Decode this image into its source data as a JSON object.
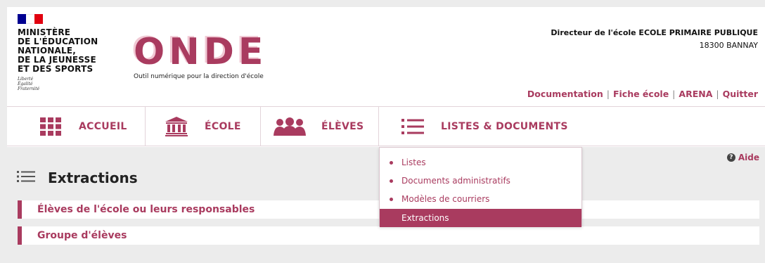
{
  "header": {
    "ministry_lines": [
      "MINISTÈRE",
      "DE L'ÉDUCATION",
      "NATIONALE,",
      "DE LA JEUNESSE",
      "ET DES SPORTS"
    ],
    "motto_lines": [
      "Liberté",
      "Égalité",
      "Fraternité"
    ],
    "app_title": "ONDE",
    "app_subtitle": "Outil numérique pour la direction d'école",
    "director_label": "Directeur de l'école ECOLE PRIMAIRE PUBLIQUE",
    "director_location": "18300 BANNAY",
    "links": [
      {
        "label": "Documentation"
      },
      {
        "label": "Fiche école"
      },
      {
        "label": "ARENA"
      },
      {
        "label": "Quitter"
      }
    ],
    "brand_color": "#a93b5f"
  },
  "nav": {
    "items": [
      {
        "label": "ACCUEIL",
        "icon": "grid-icon"
      },
      {
        "label": "ÉCOLE",
        "icon": "school-building-icon"
      },
      {
        "label": "ÉLÈVES",
        "icon": "students-group-icon"
      },
      {
        "label": "LISTES & DOCUMENTS",
        "icon": "list-icon"
      }
    ]
  },
  "dropdown": {
    "items": [
      {
        "label": "Listes"
      },
      {
        "label": "Documents administratifs"
      },
      {
        "label": "Modèles de courriers"
      },
      {
        "label": "Extractions",
        "active": true
      }
    ]
  },
  "main": {
    "help_label": "Aide",
    "page_title": "Extractions",
    "rows": [
      {
        "label": "Élèves de l'école ou leurs responsables"
      },
      {
        "label": "Groupe d'élèves"
      }
    ]
  }
}
